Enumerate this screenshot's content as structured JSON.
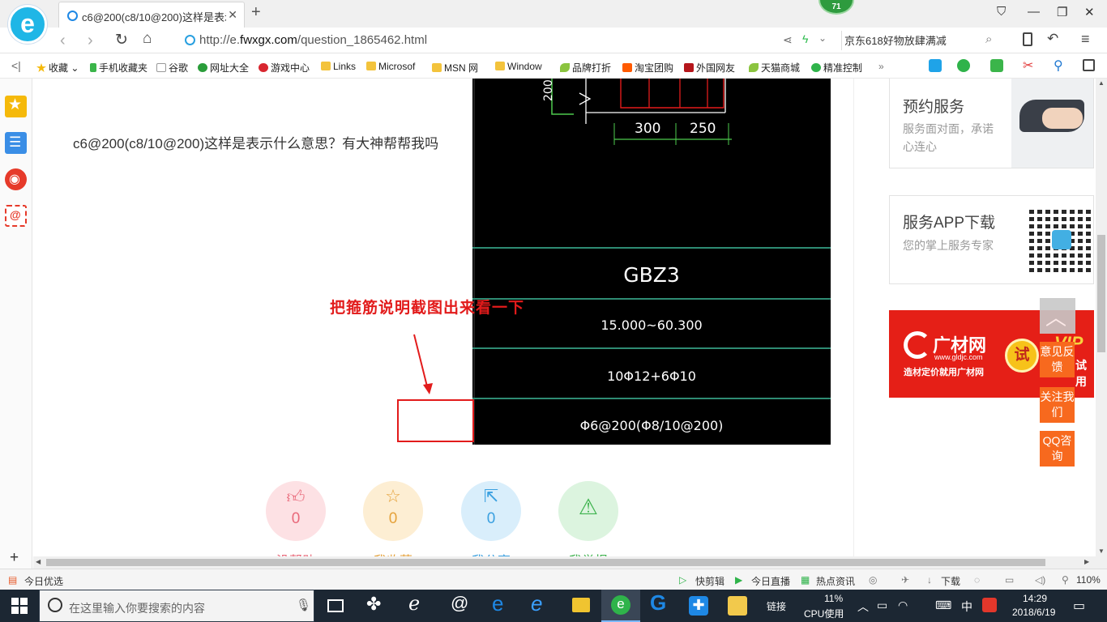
{
  "browser": {
    "tab_title": "c6@200(c8/10@200)这样是表示",
    "url_prefix": "http://e.",
    "url_domain": "fwxgx.com",
    "url_path": "/question_1865462.html",
    "search_text": "京东618好物放肆满减",
    "badge_count": "71"
  },
  "bookmarks": [
    "收藏",
    "手机收藏夹",
    "谷歌",
    "网址大全",
    "游戏中心",
    "Links",
    "Microsof",
    "MSN 网",
    "Window",
    "品牌打折",
    "淘宝团购",
    "外国网友",
    "天猫商城",
    "精准控制"
  ],
  "page": {
    "question_text": "c6@200(c8/10@200)这样是表示什么意思？有大神帮帮我吗",
    "annotation_text": "把箍筋说明截图出来看一下",
    "drawing": {
      "dim_left": "200",
      "dim_a": "300",
      "dim_b": "250",
      "name": "GBZ3",
      "elevation": "15.000~60.300",
      "longitudinal": "10Φ12+6Φ10",
      "stirrup": "Φ6@200(Φ8/10@200)"
    },
    "actions": [
      {
        "count": "0",
        "label": "没帮助"
      },
      {
        "count": "0",
        "label": "我收藏"
      },
      {
        "count": "0",
        "label": "我分享"
      },
      {
        "count": "",
        "label": "我举报"
      }
    ]
  },
  "sidebar": {
    "card1_title": "预约服务",
    "card1_sub": "服务面对面，承诺心连心",
    "card2_title": "服务APP下载",
    "card2_sub": "您的掌上服务专家",
    "ad_brand": "广材网",
    "ad_url": "www.gldjc.com",
    "ad_slogan": "造材定价就用广材网",
    "ad_try": "试",
    "ad_vip": "VIP",
    "ad_vip_sub": "试用"
  },
  "feedback": {
    "feedback": "意见反馈",
    "follow": "关注我们",
    "qq": "QQ咨询"
  },
  "statusbar": {
    "left": "今日优选",
    "items": [
      "快剪辑",
      "今日直播",
      "热点资讯",
      "下载"
    ],
    "zoom": "110%"
  },
  "taskbar": {
    "search_placeholder": "在这里输入你要搜索的内容",
    "link_label": "链接",
    "cpu": "11%",
    "cpu_label": "CPU使用",
    "ime": "中",
    "time": "14:29",
    "date": "2018/6/19"
  },
  "colors": {
    "accent": "#1fb6e6",
    "annotation": "#e21b1b",
    "feedback": "#f7691e",
    "taskbar": "#1c2733"
  }
}
